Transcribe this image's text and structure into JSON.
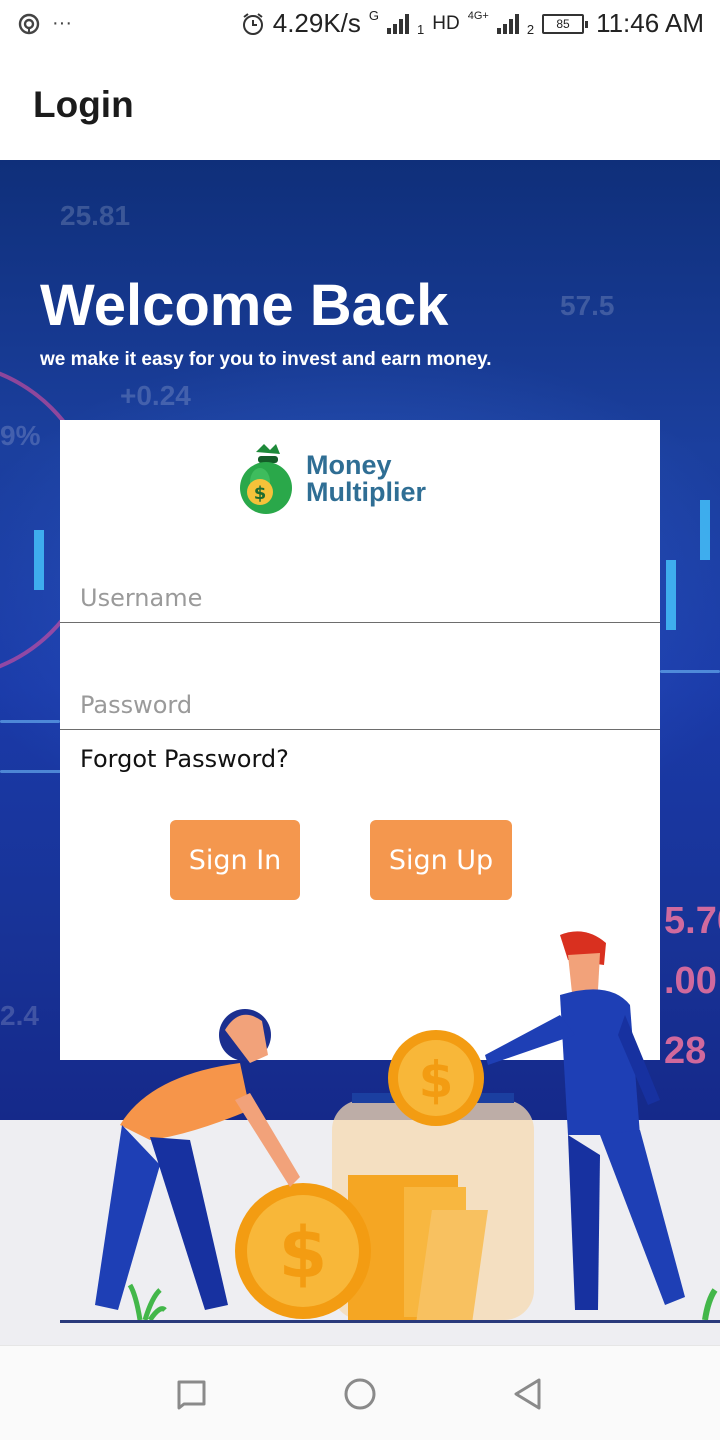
{
  "status_bar": {
    "network_speed": "4.29K/s",
    "sim1_type": "G",
    "sim2_type": "HD",
    "sim2_tech": "4G+",
    "battery": "85",
    "time": "11:46 AM",
    "dots": "···"
  },
  "app_bar": {
    "title": "Login"
  },
  "hero": {
    "title": "Welcome Back",
    "tagline": "we make it easy for you to invest and earn money."
  },
  "logo": {
    "line1": "Money",
    "line2": "Multiplier"
  },
  "form": {
    "username_placeholder": "Username",
    "password_placeholder": "Password",
    "forgot_label": "Forgot Password?",
    "signin_label": "Sign In",
    "signup_label": "Sign Up"
  },
  "colors": {
    "button": "#f4974e",
    "logo_text": "#2f6e94",
    "hero_bg": "#1b3f9e"
  },
  "icons": [
    "location-icon",
    "alarm-icon",
    "signal-icon",
    "battery-icon",
    "money-bag-icon",
    "coin-icon",
    "recent-apps-icon",
    "home-icon",
    "back-icon"
  ]
}
